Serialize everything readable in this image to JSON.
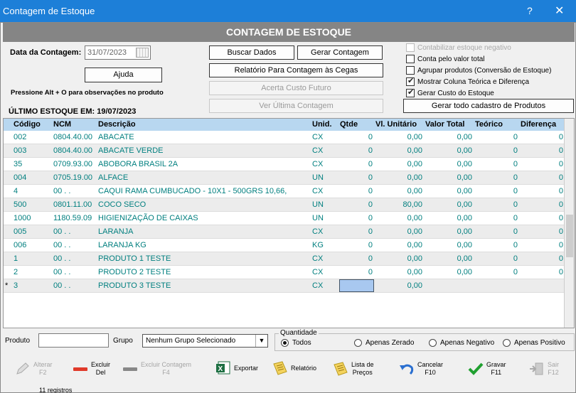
{
  "window": {
    "title": "Contagem de Estoque",
    "help_label": "?",
    "close_label": "✕"
  },
  "header": {
    "banner": "CONTAGEM DE ESTOQUE"
  },
  "form": {
    "date_label": "Data da Contagem:",
    "date_value": "31/07/2023",
    "help_button": "Ajuda",
    "hint": "Pressione Alt + O para observações no produto",
    "last_stock": "ÚLTIMO ESTOQUE EM: 19/07/2023"
  },
  "actions": {
    "buscar": "Buscar Dados",
    "gerar": "Gerar Contagem",
    "relatorio": "Relatório Para Contagem às Cegas",
    "acerta": "Acerta Custo Futuro",
    "ver": "Ver Última Contagem",
    "gerar_todo": "Gerar todo cadastro de Produtos"
  },
  "options": [
    {
      "label": "Contabilizar estoque negativo",
      "checked": false,
      "disabled": true
    },
    {
      "label": "Conta pelo valor total",
      "checked": false,
      "disabled": false
    },
    {
      "label": "Agrupar produtos (Conversão de Estoque)",
      "checked": false,
      "disabled": false
    },
    {
      "label": "Mostrar Coluna Teórica e Diferença",
      "checked": true,
      "disabled": false
    },
    {
      "label": "Gerar Custo do Estoque",
      "checked": true,
      "disabled": false
    }
  ],
  "table": {
    "columns": [
      "Código",
      "NCM",
      "Descrição",
      "Unid.",
      "Qtde",
      "Vl. Unitário",
      "Valor Total",
      "Teórico",
      "Diferença"
    ],
    "rows": [
      {
        "codigo": "002",
        "ncm": "0804.40.00",
        "desc": "ABACATE",
        "unid": "CX",
        "qtde": "0",
        "vu": "0,00",
        "vt": "0,00",
        "teo": "0",
        "dif": "0"
      },
      {
        "codigo": "003",
        "ncm": "0804.40.00",
        "desc": "ABACATE VERDE",
        "unid": "CX",
        "qtde": "0",
        "vu": "0,00",
        "vt": "0,00",
        "teo": "0",
        "dif": "0"
      },
      {
        "codigo": "35",
        "ncm": "0709.93.00",
        "desc": "ABOBORA BRASIL 2A",
        "unid": "CX",
        "qtde": "0",
        "vu": "0,00",
        "vt": "0,00",
        "teo": "0",
        "dif": "0"
      },
      {
        "codigo": "004",
        "ncm": "0705.19.00",
        "desc": "ALFACE",
        "unid": "UN",
        "qtde": "0",
        "vu": "0,00",
        "vt": "0,00",
        "teo": "0",
        "dif": "0"
      },
      {
        "codigo": "4",
        "ncm": "00 .  .",
        "desc": "CAQUI RAMA CUMBUCADO - 10X1 - 500GRS 10,66,",
        "unid": "CX",
        "qtde": "0",
        "vu": "0,00",
        "vt": "0,00",
        "teo": "0",
        "dif": "0"
      },
      {
        "codigo": "500",
        "ncm": "0801.11.00",
        "desc": "COCO SECO",
        "unid": "UN",
        "qtde": "0",
        "vu": "80,00",
        "vt": "0,00",
        "teo": "0",
        "dif": "0"
      },
      {
        "codigo": "1000",
        "ncm": "1180.59.09",
        "desc": "HIGIENIZAÇÃO DE CAIXAS",
        "unid": "UN",
        "qtde": "0",
        "vu": "0,00",
        "vt": "0,00",
        "teo": "0",
        "dif": "0"
      },
      {
        "codigo": "005",
        "ncm": "00 .  .",
        "desc": "LARANJA",
        "unid": "CX",
        "qtde": "0",
        "vu": "0,00",
        "vt": "0,00",
        "teo": "0",
        "dif": "0"
      },
      {
        "codigo": "006",
        "ncm": "00 .  .",
        "desc": "LARANJA KG",
        "unid": "KG",
        "qtde": "0",
        "vu": "0,00",
        "vt": "0,00",
        "teo": "0",
        "dif": "0"
      },
      {
        "codigo": "1",
        "ncm": "00 .  .",
        "desc": "PRODUTO 1 TESTE",
        "unid": "CX",
        "qtde": "0",
        "vu": "0,00",
        "vt": "0,00",
        "teo": "0",
        "dif": "0"
      },
      {
        "codigo": "2",
        "ncm": "00 .  .",
        "desc": "PRODUTO 2 TESTE",
        "unid": "CX",
        "qtde": "0",
        "vu": "0,00",
        "vt": "0,00",
        "teo": "0",
        "dif": "0"
      },
      {
        "codigo": "3",
        "ncm": "00 .  .",
        "desc": "PRODUTO 3 TESTE",
        "unid": "CX",
        "qtde": "",
        "vu": "0,00",
        "vt": "",
        "teo": "",
        "dif": ""
      }
    ],
    "new_row_marker": "*"
  },
  "filters": {
    "produto_label": "Produto",
    "grupo_label": "Grupo",
    "grupo_value": "Nenhum Grupo Selecionado",
    "quantidade_label": "Quantidade",
    "radios": [
      {
        "label": "Todos",
        "selected": true
      },
      {
        "label": "Apenas Zerado",
        "selected": false
      },
      {
        "label": "Apenas Negativo",
        "selected": false
      },
      {
        "label": "Apenas Positivo",
        "selected": false
      }
    ]
  },
  "toolbar": {
    "alterar": "Alterar",
    "alterar_key": "F2",
    "excluir": "Excluir",
    "excluir_key": "Del",
    "excluir_contagem": "Excluir Contagem",
    "excluir_contagem_key": "F4",
    "exportar": "Exportar",
    "relatorio": "Relatório",
    "lista": "Lista de",
    "lista2": "Preços",
    "cancelar": "Cancelar",
    "cancelar_key": "F10",
    "gravar": "Gravar",
    "gravar_key": "F11",
    "sair": "Sair",
    "sair_key": "F12"
  },
  "status": {
    "registros": "11 registros"
  },
  "colors": {
    "title": "#1d7fd8",
    "header_grid": "#b8d7f0",
    "row_text": "#007f7f",
    "banner": "#858585"
  }
}
